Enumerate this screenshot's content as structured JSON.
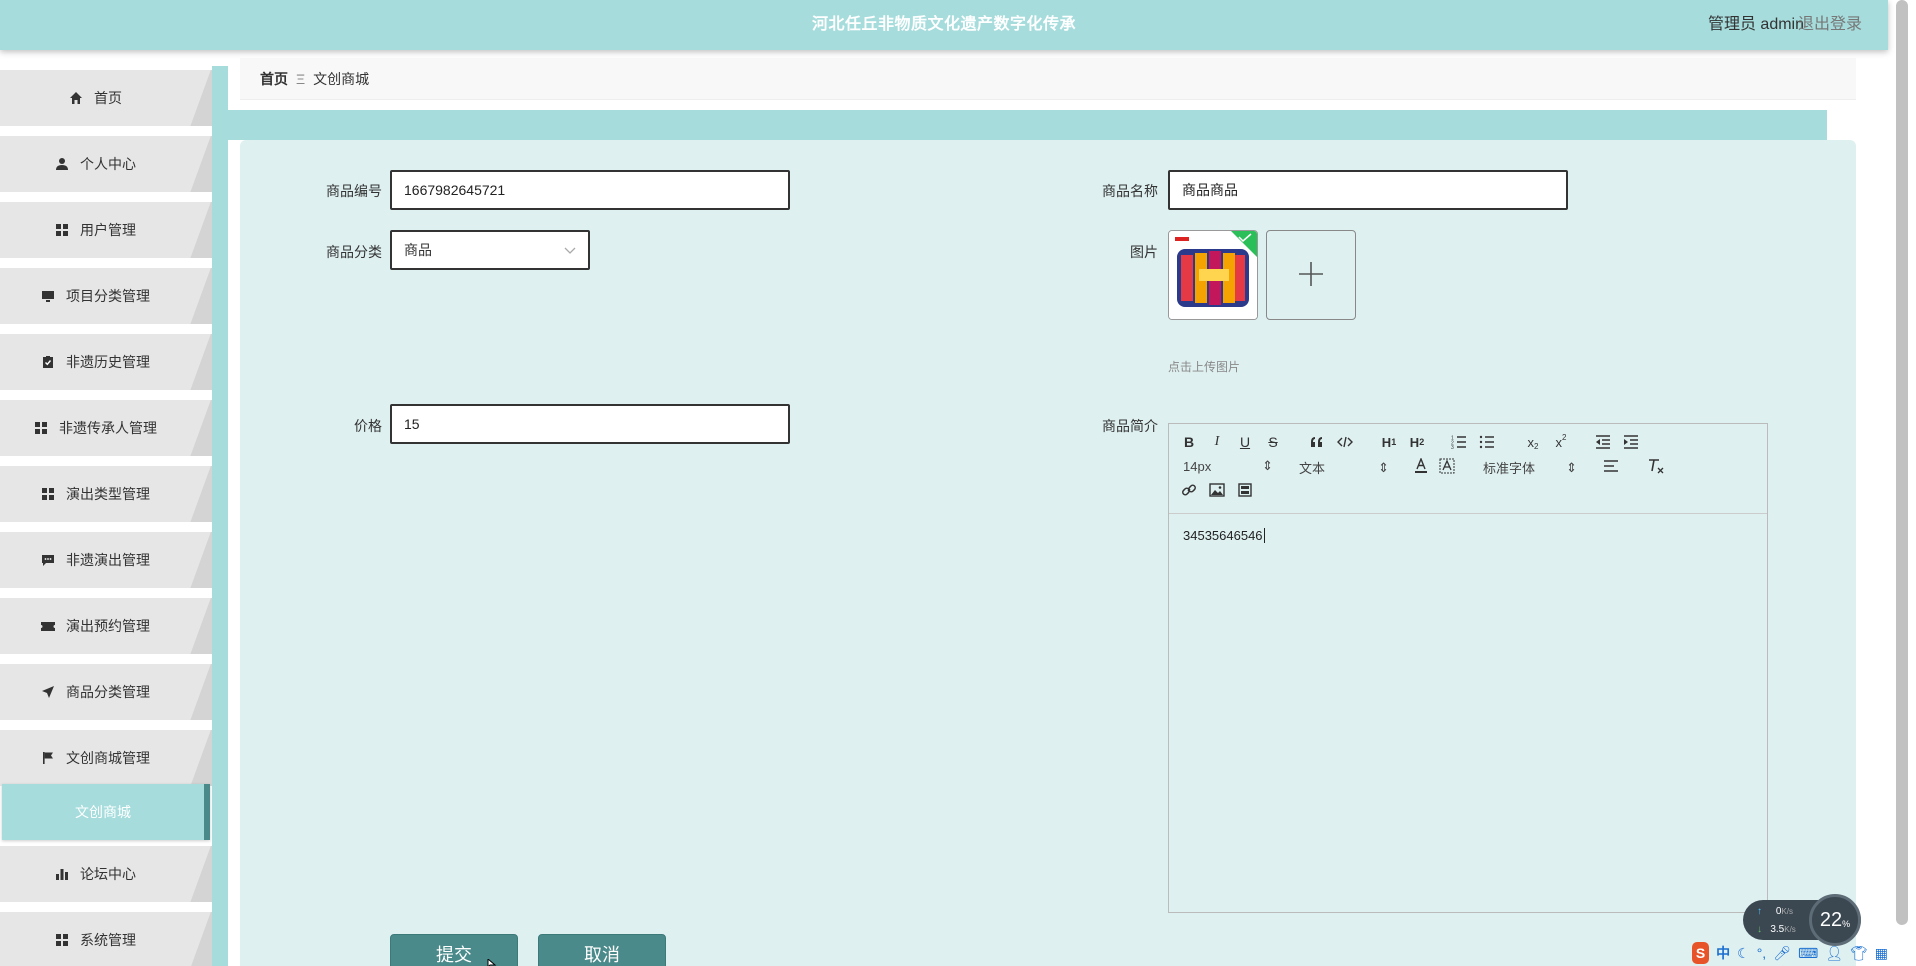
{
  "header": {
    "title": "河北任丘非物质文化遗产数字化传承",
    "user": "管理员 admin",
    "logout": "退出登录"
  },
  "sidebar": {
    "items": [
      {
        "label": "首页",
        "icon": "home-icon"
      },
      {
        "label": "个人中心",
        "icon": "user-icon"
      },
      {
        "label": "用户管理",
        "icon": "grid-icon"
      },
      {
        "label": "项目分类管理",
        "icon": "monitor-icon"
      },
      {
        "label": "非遗历史管理",
        "icon": "clipboard-icon"
      },
      {
        "label": "非遗传承人管理",
        "icon": "grid-icon"
      },
      {
        "label": "演出类型管理",
        "icon": "grid-icon"
      },
      {
        "label": "非遗演出管理",
        "icon": "chat-icon"
      },
      {
        "label": "演出预约管理",
        "icon": "ticket-icon"
      },
      {
        "label": "商品分类管理",
        "icon": "send-icon"
      },
      {
        "label": "文创商城管理",
        "icon": "flag-icon"
      }
    ],
    "active_sub": "文创商城",
    "after": [
      {
        "label": "论坛中心",
        "icon": "bar-chart-icon"
      },
      {
        "label": "系统管理",
        "icon": "grid-icon"
      }
    ]
  },
  "breadcrumb": {
    "home": "首页",
    "sep": "Ξ",
    "current": "文创商城"
  },
  "form": {
    "code_label": "商品编号",
    "code_value": "1667982645721",
    "name_label": "商品名称",
    "name_value": "商品商品",
    "category_label": "商品分类",
    "category_value": "商品",
    "image_label": "图片",
    "upload_tip": "点击上传图片",
    "price_label": "价格",
    "price_value": "15",
    "intro_label": "商品简介",
    "intro_value": "34535646546"
  },
  "editor": {
    "font_size": "14px",
    "block_type": "文本",
    "font_family": "标准字体"
  },
  "buttons": {
    "submit": "提交",
    "cancel": "取消"
  },
  "tray": {
    "up_speed": "0",
    "up_unit": "K/s",
    "down_speed": "3.5",
    "down_unit": "K/s",
    "percent": "22",
    "percent_unit": "%",
    "ime": "中"
  },
  "colors": {
    "accent": "#a6dcdc",
    "button": "#4a8a8a",
    "card": "#dff0f0"
  }
}
